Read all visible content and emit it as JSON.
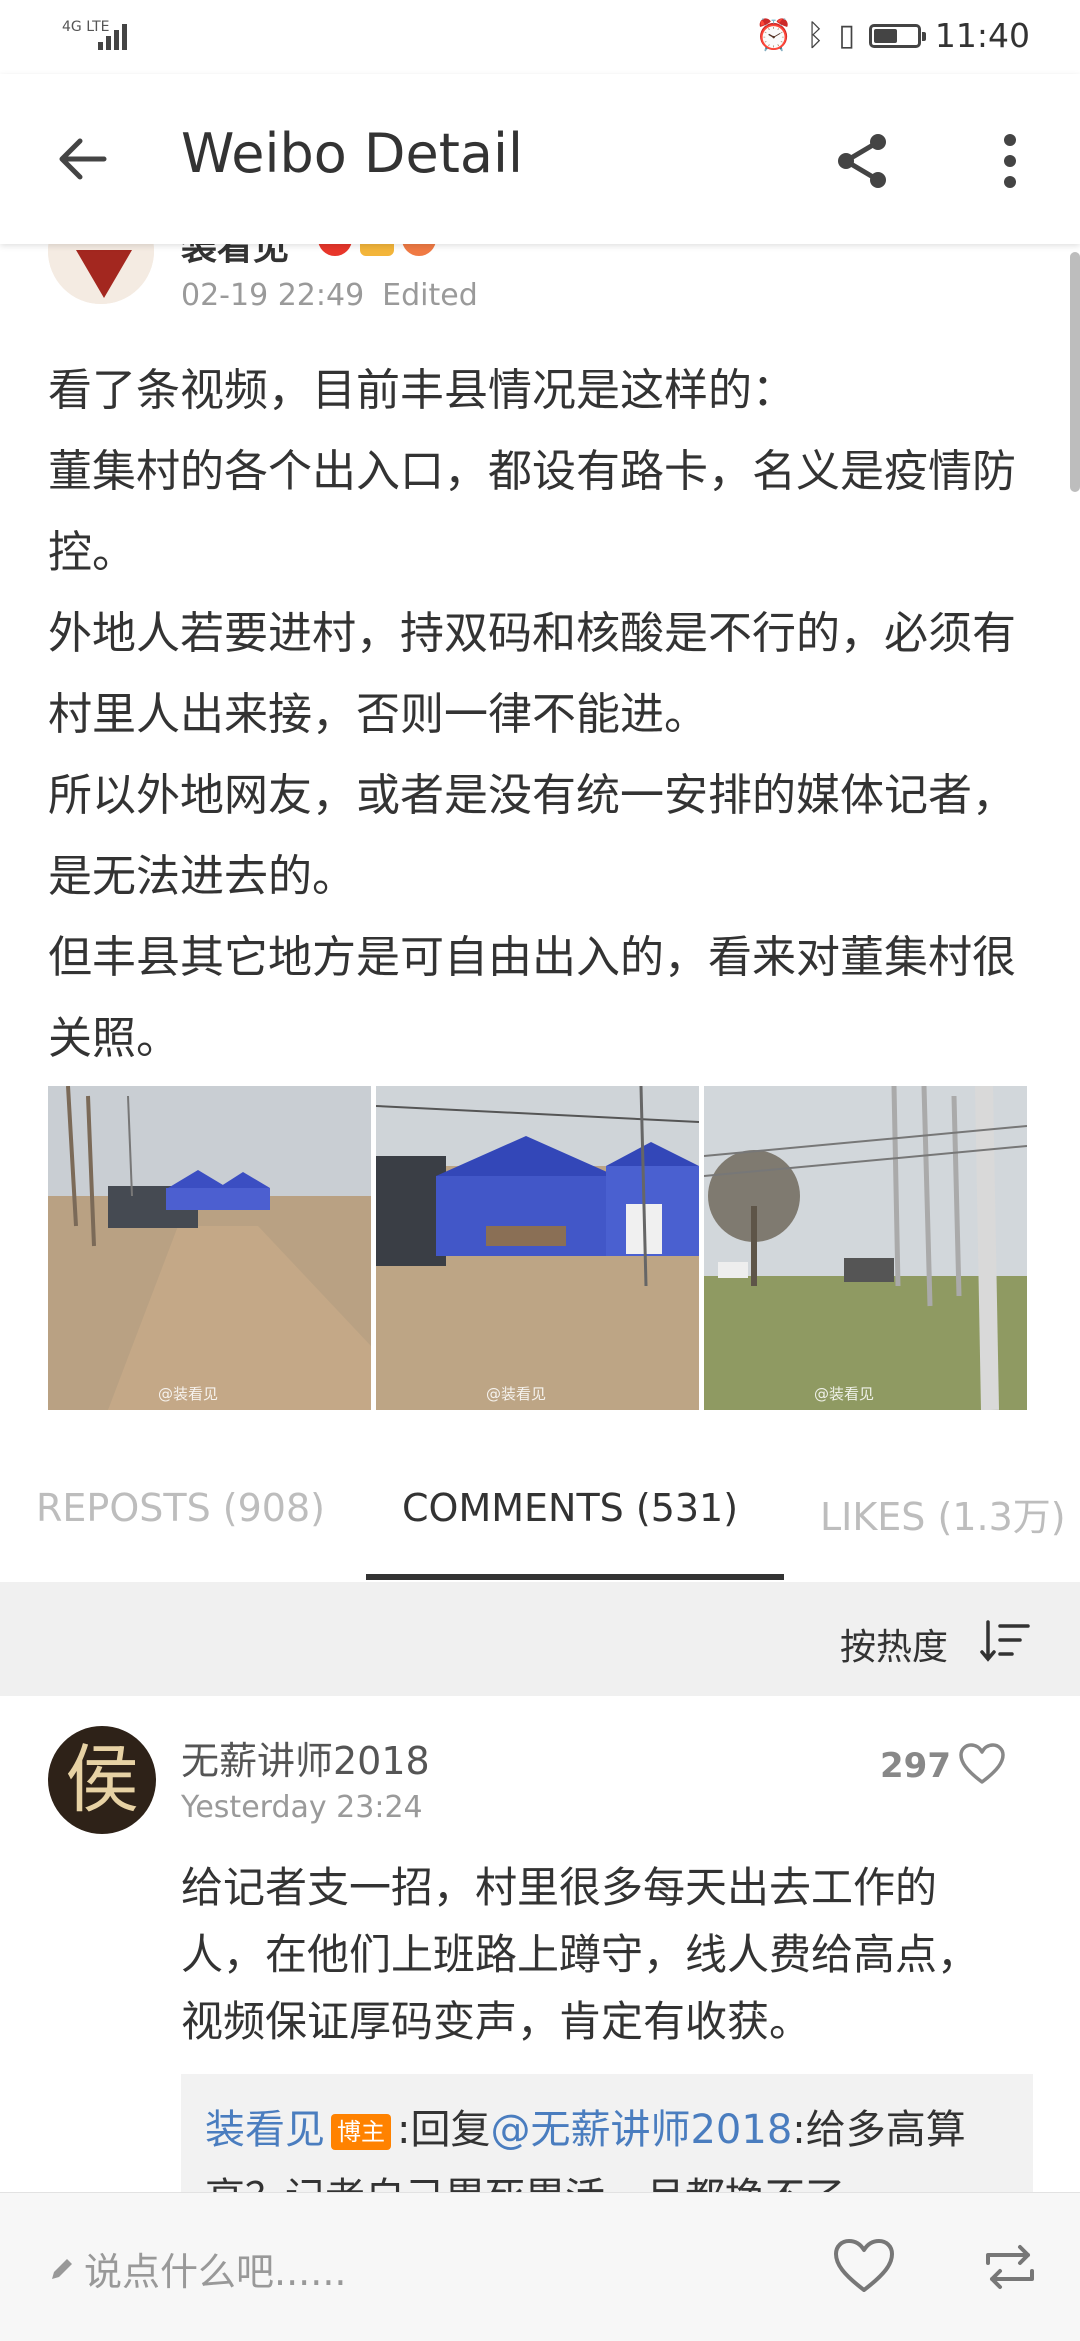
{
  "status_bar": {
    "network": "4G LTE",
    "time": "11:40",
    "battery_level": 0.5
  },
  "app_bar": {
    "title": "Weibo Detail"
  },
  "post": {
    "author": "装看见",
    "date": "02-19 22:49",
    "edited": "Edited",
    "paragraphs": [
      "看了条视频，目前丰县情况是这样的：",
      "董集村的各个出入口，都设有路卡，名义是疫情防控。",
      "外地人若要进村，持双码和核酸是不行的，必须有村里人出来接，否则一律不能进。",
      "所以外地网友，或者是没有统一安排的媒体记者，是无法进去的。",
      "但丰县其它地方是可自由出入的，看来对董集村很关照。"
    ],
    "images": [
      {
        "desc": "roadblock-tents-photo-1",
        "watermark": "@装看见"
      },
      {
        "desc": "roadblock-tents-photo-2",
        "watermark": "@装看见"
      },
      {
        "desc": "village-road-photo-3",
        "watermark": "@装看见"
      }
    ]
  },
  "tabs": [
    {
      "label": "REPOSTS (908)"
    },
    {
      "label": "COMMENTS (531)"
    },
    {
      "label": "LIKES (1.3万)"
    }
  ],
  "sort": {
    "label": "按热度"
  },
  "comment": {
    "user": "无薪讲师2018",
    "time": "Yesterday 23:24",
    "likes": "297",
    "text": "给记者支一招，村里很多每天出去工作的人，在他们上班路上蹲守，线人费给高点，视频保证厚码变声，肯定有收获。",
    "reply": {
      "user": "装看见",
      "tag": "博主",
      "prefix": ":回复",
      "mention": "@无薪讲师2018",
      "text": ":给多高算高？记者自己累死累活一月都挣不了"
    }
  },
  "bottom_bar": {
    "compose_placeholder": "说点什么吧......"
  }
}
